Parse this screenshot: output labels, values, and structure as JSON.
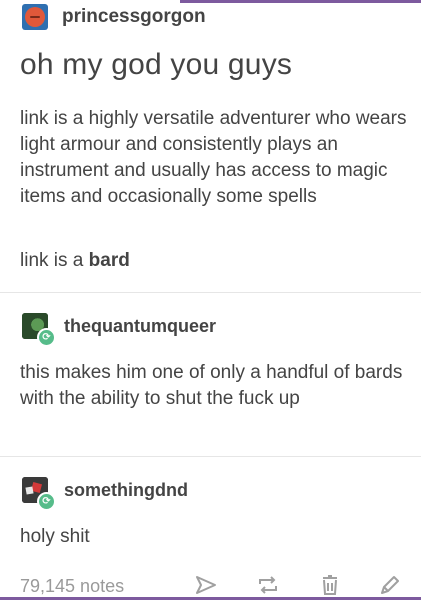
{
  "posts": [
    {
      "username": "princessgorgon",
      "heading": "oh my god you guys",
      "paragraphs": [
        "link is a highly versatile adventurer who wears light armour and consistently plays an instrument and usually has access to magic items and occasionally some spells"
      ],
      "closing_prefix": "link is a ",
      "closing_bold": "bard"
    },
    {
      "username": "thequantumqueer",
      "text": "this makes him one of only a handful of bards with the ability to shut the fuck up"
    },
    {
      "username": "somethingdnd",
      "text": "holy shit"
    }
  ],
  "footer": {
    "notes": "79,145 notes",
    "icons": [
      "share-icon",
      "reblog-icon",
      "delete-icon",
      "edit-icon"
    ]
  },
  "colors": {
    "accent": "#7d5a9e",
    "text": "#444444",
    "muted": "#9a9a9a",
    "reblog_green": "#56bc8a"
  }
}
